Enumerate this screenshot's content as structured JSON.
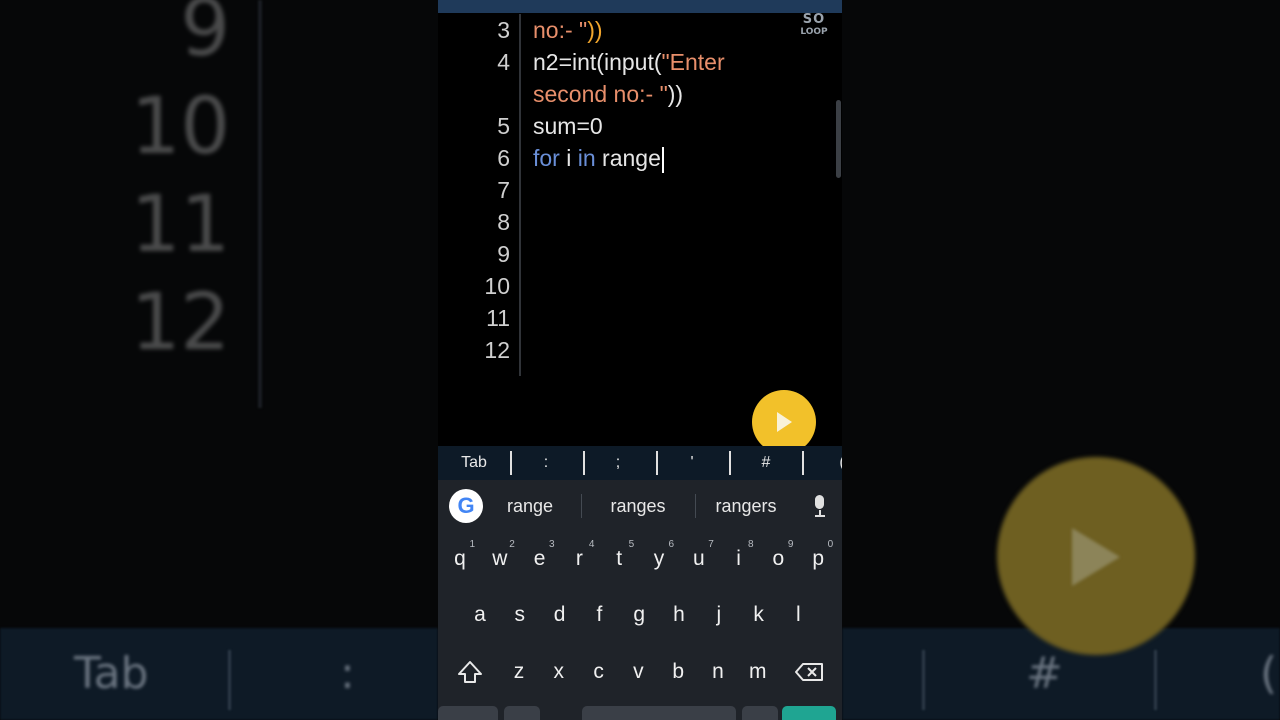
{
  "background": {
    "line_numbers": [
      "9",
      "10",
      "11",
      "12"
    ],
    "bar_items": [
      "Tab",
      ":",
      "#",
      "("
    ]
  },
  "phone": {
    "logo_line1": "SO",
    "logo_line2": "LOOP",
    "lines": [
      {
        "num": "3",
        "parts": [
          {
            "t": "no:- \"",
            "c": "str"
          },
          {
            "t": "))",
            "c": "paren"
          }
        ]
      },
      {
        "num": "4",
        "parts": [
          {
            "t": "n2=int(input(",
            "c": "plain"
          },
          {
            "t": "\"Enter",
            "c": "str"
          }
        ]
      },
      {
        "num": "",
        "parts": [
          {
            "t": "second no:- \"",
            "c": "str"
          },
          {
            "t": "))",
            "c": "plain"
          }
        ]
      },
      {
        "num": "5",
        "parts": [
          {
            "t": "sum=0",
            "c": "plain"
          }
        ]
      },
      {
        "num": "6",
        "parts": [
          {
            "t": "for",
            "c": "kw"
          },
          {
            "t": " i ",
            "c": "plain"
          },
          {
            "t": "in",
            "c": "kw"
          },
          {
            "t": " range",
            "c": "plain"
          }
        ],
        "cursor": true
      },
      {
        "num": "7",
        "parts": []
      },
      {
        "num": "8",
        "parts": []
      },
      {
        "num": "9",
        "parts": []
      },
      {
        "num": "10",
        "parts": []
      },
      {
        "num": "11",
        "parts": []
      },
      {
        "num": "12",
        "parts": []
      }
    ],
    "symbols": [
      "Tab",
      ":",
      ";",
      "'",
      "#",
      "("
    ],
    "suggestions": [
      "range",
      "ranges",
      "rangers"
    ],
    "google_letter": "G",
    "keys_row1": [
      {
        "k": "q",
        "h": "1"
      },
      {
        "k": "w",
        "h": "2"
      },
      {
        "k": "e",
        "h": "3"
      },
      {
        "k": "r",
        "h": "4"
      },
      {
        "k": "t",
        "h": "5"
      },
      {
        "k": "y",
        "h": "6"
      },
      {
        "k": "u",
        "h": "7"
      },
      {
        "k": "i",
        "h": "8"
      },
      {
        "k": "o",
        "h": "9"
      },
      {
        "k": "p",
        "h": "0"
      }
    ],
    "keys_row2": [
      "a",
      "s",
      "d",
      "f",
      "g",
      "h",
      "j",
      "k",
      "l"
    ],
    "keys_row3": [
      "z",
      "x",
      "c",
      "v",
      "b",
      "n",
      "m"
    ],
    "icons": {
      "shift": "shift-icon",
      "backspace": "backspace-icon",
      "mic": "mic-icon",
      "run": "play-icon"
    },
    "colors": {
      "run_button": "#f2c12a",
      "keyword": "#6a8fd8",
      "string": "#e88f6b",
      "paren": "#f0a52d",
      "symbol_bar": "#0d1a27",
      "keyboard": "#1f2329"
    }
  }
}
